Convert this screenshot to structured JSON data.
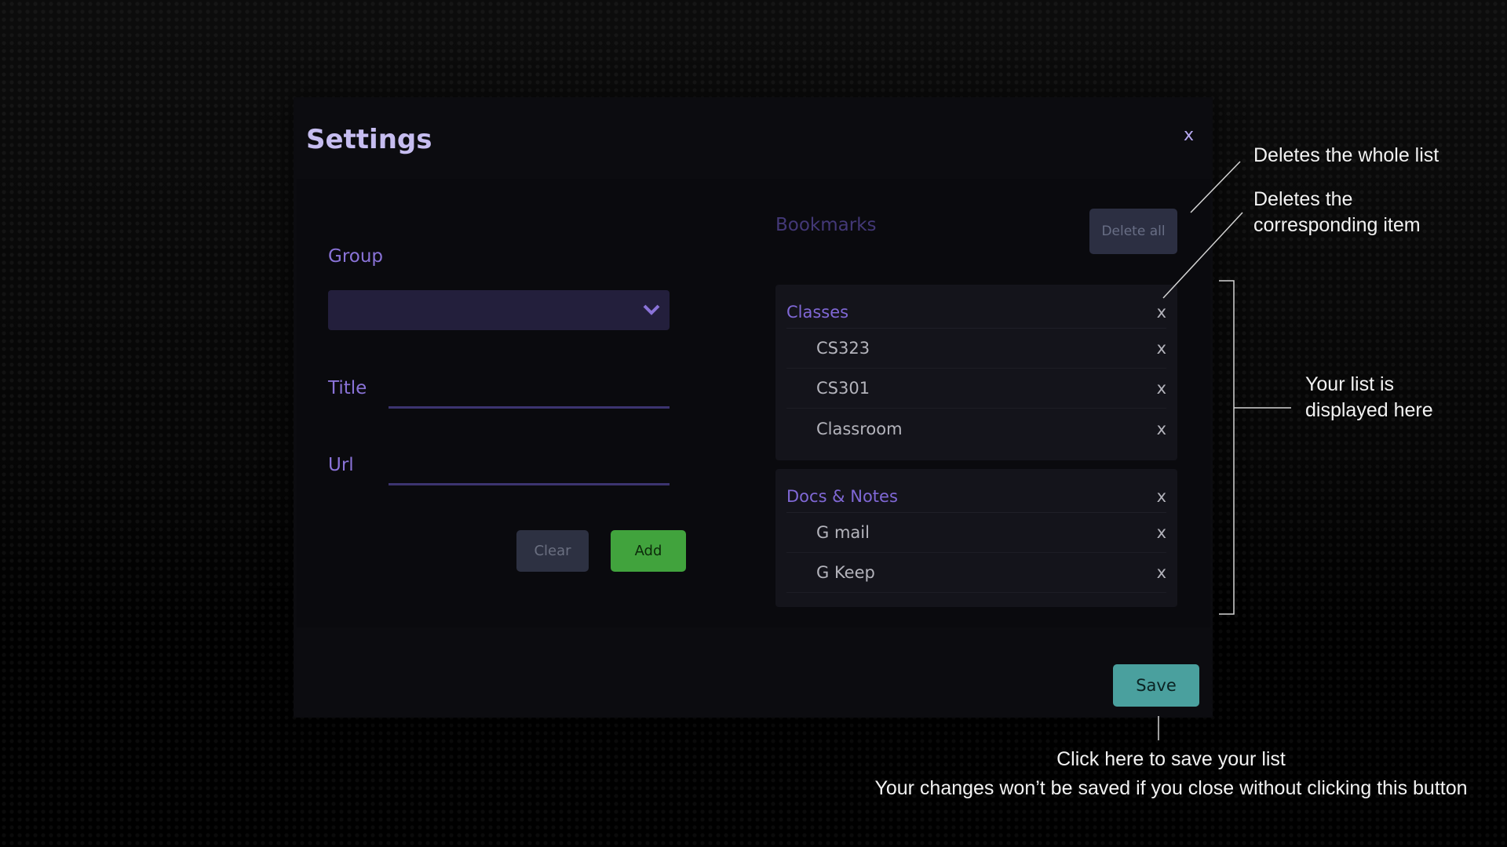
{
  "modal": {
    "title": "Settings",
    "close_label": "x"
  },
  "form": {
    "group_label": "Group",
    "group_value": "",
    "title_label": "Title",
    "title_value": "",
    "url_label": "Url",
    "url_value": "",
    "clear_label": "Clear",
    "add_label": "Add"
  },
  "bookmarks": {
    "heading": "Bookmarks",
    "delete_all_label": "Delete all",
    "delete_label": "x",
    "groups": [
      {
        "name": "Classes",
        "items": [
          "CS323",
          "CS301",
          "Classroom"
        ]
      },
      {
        "name": "Docs & Notes",
        "items": [
          "G mail",
          "G Keep"
        ]
      }
    ]
  },
  "save_label": "Save",
  "annotations": {
    "delete_all": "Deletes the whole list",
    "delete_item_line1": "Deletes the",
    "delete_item_line2": "corresponding item",
    "list_line1": "Your list is",
    "list_line2": "displayed here",
    "save_line1": "Click here to save your list",
    "save_line2": "Your changes won’t be saved if you close without clicking this button"
  },
  "colors": {
    "accent": "#8068d6",
    "add": "#41a33d",
    "save": "#4aa09e"
  }
}
